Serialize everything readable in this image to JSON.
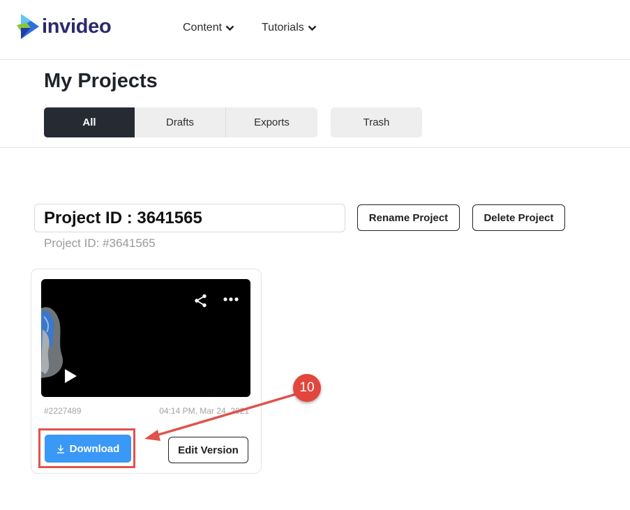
{
  "header": {
    "logo_text": "invideo",
    "nav": [
      {
        "label": "Content"
      },
      {
        "label": "Tutorials"
      }
    ]
  },
  "page": {
    "title": "My Projects",
    "tabs": [
      {
        "label": "All",
        "active": true
      },
      {
        "label": "Drafts",
        "active": false
      },
      {
        "label": "Exports",
        "active": false
      },
      {
        "label": "Trash",
        "active": false
      }
    ]
  },
  "project": {
    "name_value": "Project ID : 3641565",
    "subtitle": "Project ID: #3641565",
    "rename_label": "Rename Project",
    "delete_label": "Delete Project"
  },
  "video_card": {
    "id": "#2227489",
    "date": "04:14 PM, Mar 24, 2021",
    "download_label": "Download",
    "edit_label": "Edit Version"
  },
  "annotation": {
    "step": "10",
    "color": "#e2463c"
  },
  "colors": {
    "accent_blue": "#3a98f6",
    "active_tab": "#252a33",
    "brand_navy": "#2b2a6b"
  },
  "icons": [
    "invideo-logo-icon",
    "chevron-down-icon",
    "share-icon",
    "more-icon",
    "play-icon",
    "download-icon"
  ]
}
